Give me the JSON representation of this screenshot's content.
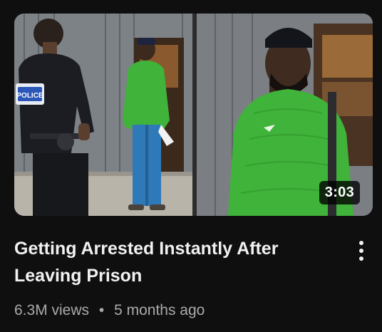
{
  "video": {
    "title": "Getting Arrested Instantly After Leaving Prison",
    "views": "6.3M views",
    "separator": "•",
    "age": "5 months ago",
    "duration": "3:03",
    "thumbnail_badge_text": "POLICE"
  },
  "icons": {
    "menu": "more-vert-icon"
  },
  "colors": {
    "background": "#0f0f0f",
    "title": "#f1f1f1",
    "meta": "#aaaaaa",
    "jacket_green": "#3fb33a",
    "jeans_blue": "#2e7ab8",
    "police_uniform": "#1c1d22"
  }
}
